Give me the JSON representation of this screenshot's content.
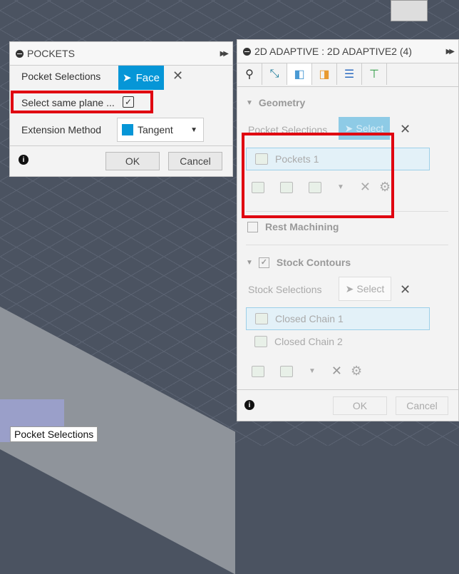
{
  "pockets": {
    "title": "POCKETS",
    "pocket_selections_label": "Pocket Selections",
    "face_button": "Face",
    "same_plane_label": "Select same plane ...",
    "same_plane_checked": true,
    "extension_label": "Extension Method",
    "extension_value": "Tangent",
    "ok": "OK",
    "cancel": "Cancel"
  },
  "adaptive": {
    "title": "2D ADAPTIVE : 2D ADAPTIVE2 (4)",
    "geometry": "Geometry",
    "pocket_selections_label": "Pocket Selections",
    "select": "Select",
    "pockets_item": "Pockets 1",
    "rest_machining": "Rest Machining",
    "stock_contours": "Stock Contours",
    "stock_selections_label": "Stock Selections",
    "stock_select": "Select",
    "chains": [
      "Closed Chain 1",
      "Closed Chain 2"
    ],
    "ok": "OK",
    "cancel": "Cancel"
  },
  "tooltip": "Pocket Selections",
  "colors": {
    "accent": "#0696d7",
    "highlight": "#e00010"
  }
}
